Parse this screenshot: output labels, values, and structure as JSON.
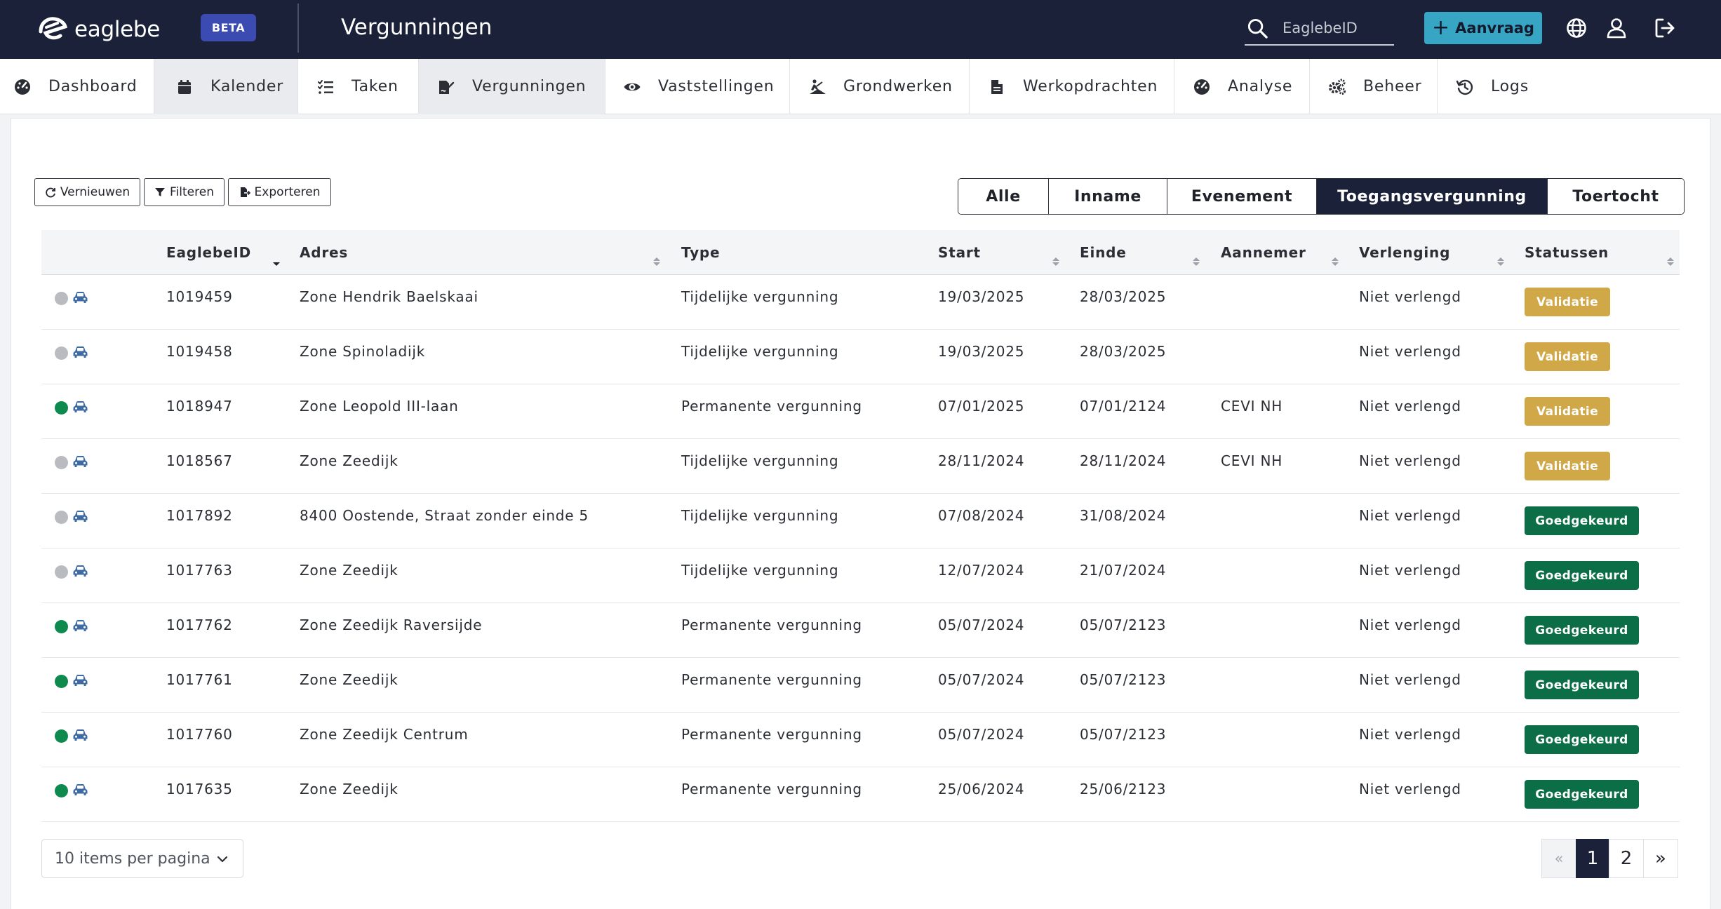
{
  "app": {
    "logo_text": "eaglebe",
    "badge": "BETA",
    "title": "Vergunningen"
  },
  "header": {
    "search_placeholder": "EaglebeID",
    "request_button": "Aanvraag"
  },
  "nav": [
    {
      "label": "Dashboard",
      "icon": "gauge-icon"
    },
    {
      "label": "Kalender",
      "icon": "calendar-icon"
    },
    {
      "label": "Taken",
      "icon": "tasks-icon"
    },
    {
      "label": "Vergunningen",
      "icon": "file-signature-icon"
    },
    {
      "label": "Vaststellingen",
      "icon": "eye-icon"
    },
    {
      "label": "Grondwerken",
      "icon": "digging-icon"
    },
    {
      "label": "Werkopdrachten",
      "icon": "file-icon"
    },
    {
      "label": "Analyse",
      "icon": "gauge-icon"
    },
    {
      "label": "Beheer",
      "icon": "gears-icon"
    },
    {
      "label": "Logs",
      "icon": "history-icon"
    }
  ],
  "toolbar": {
    "refresh": "Vernieuwen",
    "filter": "Filteren",
    "export": "Exporteren"
  },
  "filter_tabs": [
    "Alle",
    "Inname",
    "Evenement",
    "Toegangsvergunning",
    "Toertocht"
  ],
  "table": {
    "columns": [
      "EaglebeID",
      "Adres",
      "Type",
      "Start",
      "Einde",
      "Aannemer",
      "Verlenging",
      "Statussen"
    ],
    "rows": [
      {
        "status_color": "#b9bbc0",
        "id": "1019459",
        "adres": "Zone Hendrik Baelskaai",
        "type": "Tijdelijke vergunning",
        "start": "19/03/2025",
        "einde": "28/03/2025",
        "aannemer": "",
        "verlenging": "Niet verlengd",
        "status": "Validatie"
      },
      {
        "status_color": "#b9bbc0",
        "id": "1019458",
        "adres": "Zone Spinoladijk",
        "type": "Tijdelijke vergunning",
        "start": "19/03/2025",
        "einde": "28/03/2025",
        "aannemer": "",
        "verlenging": "Niet verlengd",
        "status": "Validatie"
      },
      {
        "status_color": "#0f8a4f",
        "id": "1018947",
        "adres": "Zone Leopold III-laan",
        "type": "Permanente vergunning",
        "start": "07/01/2025",
        "einde": "07/01/2124",
        "aannemer": "CEVI NH",
        "verlenging": "Niet verlengd",
        "status": "Validatie"
      },
      {
        "status_color": "#b9bbc0",
        "id": "1018567",
        "adres": "Zone Zeedijk",
        "type": "Tijdelijke vergunning",
        "start": "28/11/2024",
        "einde": "28/11/2024",
        "aannemer": "CEVI NH",
        "verlenging": "Niet verlengd",
        "status": "Validatie"
      },
      {
        "status_color": "#b9bbc0",
        "id": "1017892",
        "adres": "8400 Oostende, Straat zonder einde 5",
        "type": "Tijdelijke vergunning",
        "start": "07/08/2024",
        "einde": "31/08/2024",
        "aannemer": "",
        "verlenging": "Niet verlengd",
        "status": "Goedgekeurd"
      },
      {
        "status_color": "#b9bbc0",
        "id": "1017763",
        "adres": "Zone Zeedijk",
        "type": "Tijdelijke vergunning",
        "start": "12/07/2024",
        "einde": "21/07/2024",
        "aannemer": "",
        "verlenging": "Niet verlengd",
        "status": "Goedgekeurd"
      },
      {
        "status_color": "#0f8a4f",
        "id": "1017762",
        "adres": "Zone Zeedijk Raversijde",
        "type": "Permanente vergunning",
        "start": "05/07/2024",
        "einde": "05/07/2123",
        "aannemer": "",
        "verlenging": "Niet verlengd",
        "status": "Goedgekeurd"
      },
      {
        "status_color": "#0f8a4f",
        "id": "1017761",
        "adres": "Zone Zeedijk",
        "type": "Permanente vergunning",
        "start": "05/07/2024",
        "einde": "05/07/2123",
        "aannemer": "",
        "verlenging": "Niet verlengd",
        "status": "Goedgekeurd"
      },
      {
        "status_color": "#0f8a4f",
        "id": "1017760",
        "adres": "Zone Zeedijk Centrum",
        "type": "Permanente vergunning",
        "start": "05/07/2024",
        "einde": "05/07/2123",
        "aannemer": "",
        "verlenging": "Niet verlengd",
        "status": "Goedgekeurd"
      },
      {
        "status_color": "#0f8a4f",
        "id": "1017635",
        "adres": "Zone Zeedijk",
        "type": "Permanente vergunning",
        "start": "25/06/2024",
        "einde": "25/06/2123",
        "aannemer": "",
        "verlenging": "Niet verlengd",
        "status": "Goedgekeurd"
      }
    ]
  },
  "footer": {
    "per_page": "10 items per pagina",
    "pager": {
      "prev": "«",
      "pages": [
        "1",
        "2"
      ],
      "current": "1",
      "next": "»"
    }
  },
  "colors": {
    "header_bg": "#1b2138",
    "accent": "#36a6c4",
    "validatie": "#d0a848",
    "goedgekeurd": "#0c6e47"
  }
}
